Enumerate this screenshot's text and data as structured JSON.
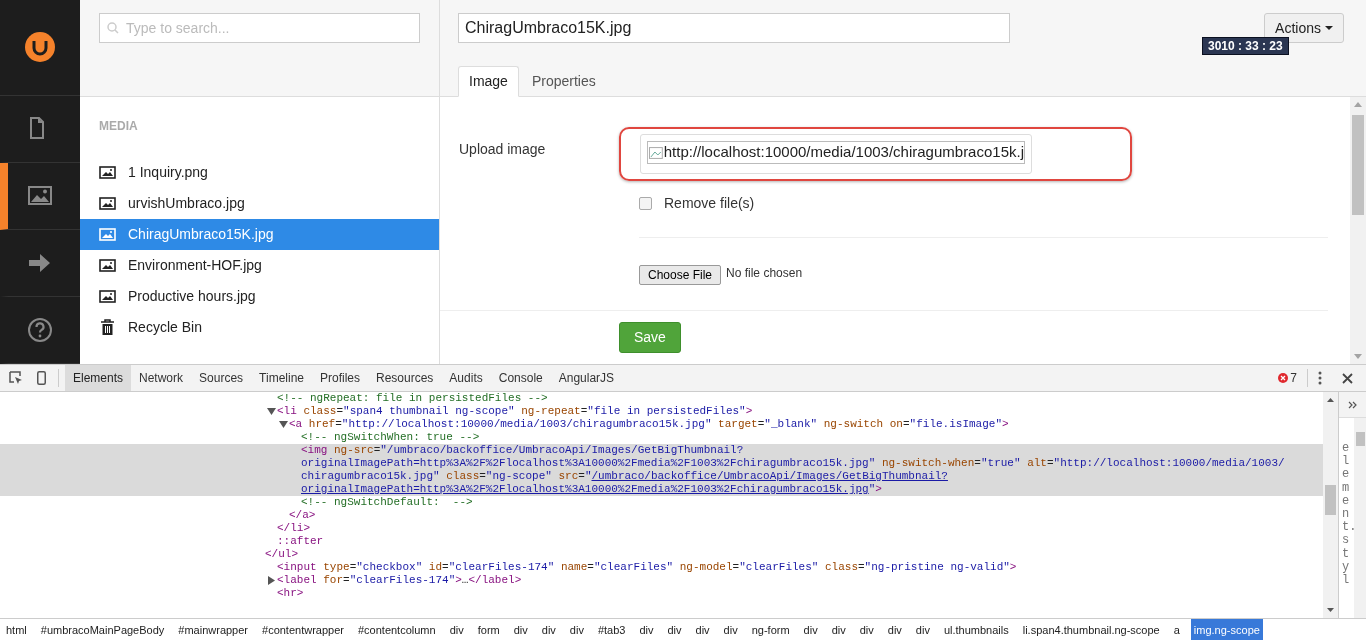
{
  "app_sidebar": {
    "sections": [
      {
        "kind": "document",
        "selected": false
      },
      {
        "kind": "media",
        "selected": true
      },
      {
        "kind": "arrow",
        "selected": false
      },
      {
        "kind": "help",
        "selected": false
      }
    ]
  },
  "tree": {
    "search": {
      "placeholder": "Type to search..."
    },
    "heading": "MEDIA",
    "items": [
      {
        "kind": "image",
        "label": "1 Inquiry.png",
        "selected": false
      },
      {
        "kind": "image",
        "label": "urvishUmbraco.jpg",
        "selected": false
      },
      {
        "kind": "image",
        "label": "ChiragUmbraco15K.jpg",
        "selected": true
      },
      {
        "kind": "image",
        "label": "Environment-HOF.jpg",
        "selected": false
      },
      {
        "kind": "image",
        "label": "Productive hours.jpg",
        "selected": false
      },
      {
        "kind": "trash",
        "label": "Recycle Bin",
        "selected": false
      }
    ]
  },
  "editor": {
    "name": "ChiragUmbraco15K.jpg",
    "actions": "Actions",
    "timer": "3010 : 33 : 23",
    "tabs": [
      {
        "label": "Image",
        "selected": true
      },
      {
        "label": "Properties",
        "selected": false
      }
    ],
    "upload_label": "Upload image",
    "image_alt": "http://localhost:10000/media/1003/chiragumbraco15k.j",
    "remove_files": {
      "label": "Remove file(s)",
      "checked": false
    },
    "choose_file": "Choose File",
    "no_file": "No file chosen",
    "save": "Save"
  },
  "devtools": {
    "tabs": [
      {
        "label": "Elements",
        "selected": true
      },
      {
        "label": "Network",
        "selected": false
      },
      {
        "label": "Sources",
        "selected": false
      },
      {
        "label": "Timeline",
        "selected": false
      },
      {
        "label": "Profiles",
        "selected": false
      },
      {
        "label": "Resources",
        "selected": false
      },
      {
        "label": "Audits",
        "selected": false
      },
      {
        "label": "Console",
        "selected": false
      },
      {
        "label": "AngularJS",
        "selected": false
      }
    ],
    "error_count": "7",
    "side_panel": "element.styl",
    "dom": [
      {
        "children": [
          {
            "lines": [
              [
                {
                  "kind": "comment",
                  "text": "<!-- ngRepeat: file in persistedFiles -->"
                }
              ]
            ]
          },
          {
            "expanded": true,
            "lines": [
              [
                {
                  "kind": "tag",
                  "text": "<li"
                },
                {
                  "kind": "attr",
                  "text": " class"
                },
                {
                  "kind": "punct",
                  "text": "="
                },
                {
                  "kind": "value",
                  "text": "\"span4 thumbnail ng-scope\""
                },
                {
                  "kind": "attr",
                  "text": " ng-repeat"
                },
                {
                  "kind": "punct",
                  "text": "="
                },
                {
                  "kind": "value",
                  "text": "\"file in persistedFiles\""
                },
                {
                  "kind": "tag",
                  "text": ">"
                }
              ]
            ],
            "children": [
              {
                "expanded": true,
                "lines": [
                  [
                    {
                      "kind": "tag",
                      "text": "<a"
                    },
                    {
                      "kind": "attr",
                      "text": " href"
                    },
                    {
                      "kind": "punct",
                      "text": "="
                    },
                    {
                      "kind": "value",
                      "text": "\"http://localhost:10000/media/1003/chiragumbraco15k.jpg\""
                    },
                    {
                      "kind": "attr",
                      "text": " target"
                    },
                    {
                      "kind": "punct",
                      "text": "="
                    },
                    {
                      "kind": "value",
                      "text": "\"_blank\""
                    },
                    {
                      "kind": "attr",
                      "text": " ng-switch on"
                    },
                    {
                      "kind": "punct",
                      "text": "="
                    },
                    {
                      "kind": "value",
                      "text": "\"file.isImage\""
                    },
                    {
                      "kind": "tag",
                      "text": ">"
                    }
                  ]
                ],
                "children": [
                  {
                    "lines": [
                      [
                        {
                          "kind": "comment",
                          "text": "<!-- ngSwitchWhen: true -->"
                        }
                      ]
                    ]
                  },
                  {
                    "selected": true,
                    "lines": [
                      [
                        {
                          "kind": "tag",
                          "text": "<img"
                        },
                        {
                          "kind": "attr",
                          "text": " ng-src"
                        },
                        {
                          "kind": "punct",
                          "text": "="
                        },
                        {
                          "kind": "value",
                          "text": "\"/umbraco/backoffice/UmbracoApi/Images/GetBigThumbnail?"
                        }
                      ],
                      [
                        {
                          "kind": "value",
                          "text": "originalImagePath=http%3A%2F%2Flocalhost%3A10000%2Fmedia%2F1003%2Fchiragumbraco15k.jpg\""
                        },
                        {
                          "kind": "attr",
                          "text": " ng-switch-when"
                        },
                        {
                          "kind": "punct",
                          "text": "="
                        },
                        {
                          "kind": "value",
                          "text": "\"true\""
                        },
                        {
                          "kind": "attr",
                          "text": " alt"
                        },
                        {
                          "kind": "punct",
                          "text": "="
                        },
                        {
                          "kind": "value",
                          "text": "\"http://localhost:10000/media/1003/"
                        }
                      ],
                      [
                        {
                          "kind": "value",
                          "text": "chiragumbraco15k.jpg\""
                        },
                        {
                          "kind": "attr",
                          "text": " class"
                        },
                        {
                          "kind": "punct",
                          "text": "="
                        },
                        {
                          "kind": "value",
                          "text": "\"ng-scope\""
                        },
                        {
                          "kind": "attr",
                          "text": " src"
                        },
                        {
                          "kind": "punct",
                          "text": "="
                        },
                        {
                          "kind": "value",
                          "text": "\""
                        },
                        {
                          "kind": "link",
                          "text": "/umbraco/backoffice/UmbracoApi/Images/GetBigThumbnail?"
                        }
                      ],
                      [
                        {
                          "kind": "link",
                          "text": "originalImagePath=http%3A%2F%2Flocalhost%3A10000%2Fmedia%2F1003%2Fchiragumbraco15k.jpg"
                        },
                        {
                          "kind": "value",
                          "text": "\""
                        },
                        {
                          "kind": "tag",
                          "text": ">"
                        }
                      ]
                    ]
                  },
                  {
                    "lines": [
                      [
                        {
                          "kind": "comment",
                          "text": "<!-- ngSwitchDefault:  -->"
                        }
                      ]
                    ]
                  }
                ],
                "close": [
                  {
                    "kind": "tag",
                    "text": "</a>"
                  }
                ]
              }
            ],
            "close": [
              {
                "kind": "tag",
                "text": "</li>"
              }
            ]
          },
          {
            "lines": [
              [
                {
                  "kind": "tag",
                  "text": "::after"
                }
              ]
            ]
          }
        ],
        "close": [
          {
            "kind": "tag",
            "text": "</ul>"
          }
        ]
      },
      {
        "lines": [
          [
            {
              "kind": "tag",
              "text": "<input"
            },
            {
              "kind": "attr",
              "text": " type"
            },
            {
              "kind": "punct",
              "text": "="
            },
            {
              "kind": "value",
              "text": "\"checkbox\""
            },
            {
              "kind": "attr",
              "text": " id"
            },
            {
              "kind": "punct",
              "text": "="
            },
            {
              "kind": "value",
              "text": "\"clearFiles-174\""
            },
            {
              "kind": "attr",
              "text": " name"
            },
            {
              "kind": "punct",
              "text": "="
            },
            {
              "kind": "value",
              "text": "\"clearFiles\""
            },
            {
              "kind": "attr",
              "text": " ng-model"
            },
            {
              "kind": "punct",
              "text": "="
            },
            {
              "kind": "value",
              "text": "\"clearFiles\""
            },
            {
              "kind": "attr",
              "text": " class"
            },
            {
              "kind": "punct",
              "text": "="
            },
            {
              "kind": "value",
              "text": "\"ng-pristine ng-valid\""
            },
            {
              "kind": "tag",
              "text": ">"
            }
          ]
        ]
      },
      {
        "expanded": false,
        "lines": [
          [
            {
              "kind": "tag",
              "text": "<label"
            },
            {
              "kind": "attr",
              "text": " for"
            },
            {
              "kind": "punct",
              "text": "="
            },
            {
              "kind": "value",
              "text": "\"clearFiles-174\""
            },
            {
              "kind": "tag",
              "text": ">"
            },
            {
              "kind": "plain",
              "text": "…"
            },
            {
              "kind": "tag",
              "text": "</label>"
            }
          ]
        ]
      },
      {
        "lines": [
          [
            {
              "kind": "tag",
              "text": "<hr>"
            }
          ]
        ]
      }
    ],
    "breadcrumbs": [
      {
        "label": "html",
        "selected": false
      },
      {
        "label": "#umbracoMainPageBody",
        "selected": false
      },
      {
        "label": "#mainwrapper",
        "selected": false
      },
      {
        "label": "#contentwrapper",
        "selected": false
      },
      {
        "label": "#contentcolumn",
        "selected": false
      },
      {
        "label": "div",
        "selected": false
      },
      {
        "label": "form",
        "selected": false
      },
      {
        "label": "div",
        "selected": false
      },
      {
        "label": "div",
        "selected": false
      },
      {
        "label": "div",
        "selected": false
      },
      {
        "label": "#tab3",
        "selected": false
      },
      {
        "label": "div",
        "selected": false
      },
      {
        "label": "div",
        "selected": false
      },
      {
        "label": "div",
        "selected": false
      },
      {
        "label": "div",
        "selected": false
      },
      {
        "label": "ng-form",
        "selected": false
      },
      {
        "label": "div",
        "selected": false
      },
      {
        "label": "div",
        "selected": false
      },
      {
        "label": "div",
        "selected": false
      },
      {
        "label": "div",
        "selected": false
      },
      {
        "label": "div",
        "selected": false
      },
      {
        "label": "ul.thumbnails",
        "selected": false
      },
      {
        "label": "li.span4.thumbnail.ng-scope",
        "selected": false
      },
      {
        "label": "a",
        "selected": false
      },
      {
        "label": "img.ng-scope",
        "selected": true
      }
    ]
  }
}
